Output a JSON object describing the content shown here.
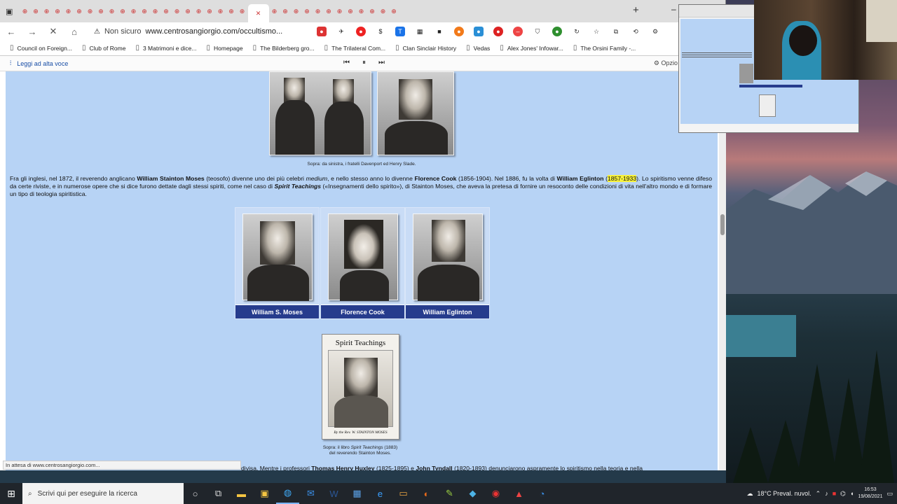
{
  "browser": {
    "tab_count": 34,
    "nav_icons": [
      "back-icon",
      "forward-icon",
      "stop-icon",
      "home-icon"
    ],
    "security_label": "Non sicuro",
    "url": "www.centrosangiorgio.com/occultismo...",
    "bookmarks": [
      "Council on Foreign...",
      "Club of Rome",
      "3 Matrimoni e dice...",
      "Homepage",
      "The Bilderberg gro...",
      "The Trilateral Com...",
      "Clan Sinclair History",
      "Vedas",
      "Alex Jones' Infowar...",
      "The Orsini Family -..."
    ],
    "read_aloud": "Leggi ad alta voce",
    "options": "Opzio",
    "status": "In attesa di www.centrosangiorgio.com..."
  },
  "page": {
    "top_caption": "Sopra: da sinistra, i fratelli Davenport ed Henry Slade.",
    "paragraph": {
      "t1": "Fra gli inglesi, nel 1872, il reverendo anglicano ",
      "b1": "William Stainton Moses",
      "t2": " (teosofo) divenne uno dei più celebri ",
      "i1": "medium",
      "t3": ", e nello stesso anno lo divenne ",
      "b2": "Florence Cook",
      "t4": " (1856-1904). Nel 1886, fu la volta di ",
      "b3": "William Eglinton",
      "t5": " (",
      "hl": "1857-1933",
      "t6": "). Lo spiritismo venne difeso da certe riviste, e in numerose opere che si dice furono dettate dagli stessi spiriti, come nel caso di ",
      "b4": "Spirit Teachings",
      "t7": " («Insegnamenti dello spirito»), di Stainton Moses, che aveva la pretesa di fornire un resoconto delle condizioni di vita nell'altro mondo e di formare un tipo di teologia spiritistica."
    },
    "portraits": [
      "William S. Moses",
      "Florence Cook",
      "William Eglinton"
    ],
    "book": {
      "title": "Spirit Teachings",
      "author": "By the Rev. W. STAINTON MOSES"
    },
    "book_caption_1": "Sopra: il libro ",
    "book_caption_i": "Spirit Teachings",
    "book_caption_2": " (1883)",
    "book_caption_3": "del reverendo Stainton Moses.",
    "bottom_t1": "divisa. Mentre i professori ",
    "bottom_b1": "Thomas Henry Huxley",
    "bottom_t2": " (1825-1895) e ",
    "bottom_b2": "John Tyndall",
    "bottom_t3": " (1820-1893) denunciarono aspramente lo spiritismo nella teoria e nella"
  },
  "taskbar": {
    "search_placeholder": "Scrivi qui per eseguire la ricerca",
    "weather": "18°C Preval. nuvol.",
    "time": "16:53",
    "date": "19/08/2021"
  },
  "colors": {
    "page_bg": "#b7d3f5",
    "label_bg": "#263c8d",
    "highlight": "#f7f13c"
  }
}
